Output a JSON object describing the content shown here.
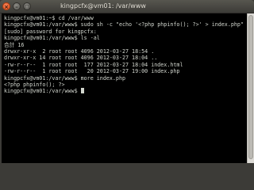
{
  "window": {
    "title": "kingpcfx@vm01: /var/www",
    "close_glyph": "×",
    "min_glyph": "–",
    "max_glyph": "□"
  },
  "terminal": {
    "lines": [
      "kingpcfx@vm01:~$ cd /var/www",
      "kingpcfx@vm01:/var/www$ sudo sh -c \"echo '<?php phpinfo(); ?>' > index.php\"",
      "[sudo] password for kingpcfx:",
      "kingpcfx@vm01:/var/www$ ls -al",
      "合計 16",
      "drwxr-xr-x  2 root root 4096 2012-03-27 18:54 .",
      "drwxr-xr-x 14 root root 4096 2012-03-27 18:04 ..",
      "-rw-r--r--  1 root root  177 2012-03-27 18:04 index.html",
      "-rw-r--r--  1 root root   20 2012-03-27 19:00 index.php",
      "kingpcfx@vm01:/var/www$ more index.php",
      "<?php phpinfo(); ?>"
    ],
    "prompt": "kingpcfx@vm01:/var/www$ "
  },
  "colors": {
    "terminal_bg": "#000000",
    "terminal_fg": "#d3d7cf",
    "titlebar": "#3c3b37",
    "close_button": "#df4b16"
  }
}
